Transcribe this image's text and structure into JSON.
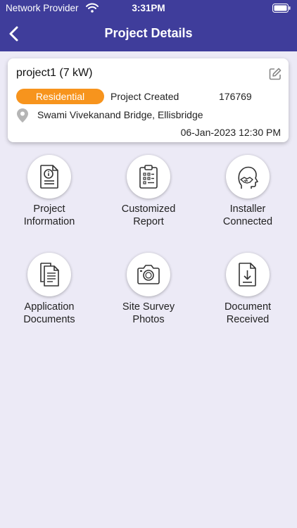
{
  "status_bar": {
    "carrier": "Network Provider",
    "time": "3:31PM"
  },
  "nav": {
    "title": "Project Details"
  },
  "project_card": {
    "name": "project1 (7 kW)",
    "category": "Residential",
    "status": "Project Created",
    "project_id": "176769",
    "address": "Swami Vivekanand Bridge, Ellisbridge",
    "date": "06-Jan-2023 12:30 PM"
  },
  "tiles": [
    {
      "label": "Project\nInformation",
      "icon": "info-document-icon"
    },
    {
      "label": "Customized\nReport",
      "icon": "clipboard-checklist-icon"
    },
    {
      "label": "Installer\nConnected",
      "icon": "handshake-person-icon"
    },
    {
      "label": "Application\nDocuments",
      "icon": "documents-stack-icon"
    },
    {
      "label": "Site Survey\nPhotos",
      "icon": "camera-icon"
    },
    {
      "label": "Document\nReceived",
      "icon": "download-document-icon"
    }
  ],
  "colors": {
    "header": "#3f3d9b",
    "badge": "#f7941d",
    "background": "#eceaf6"
  }
}
